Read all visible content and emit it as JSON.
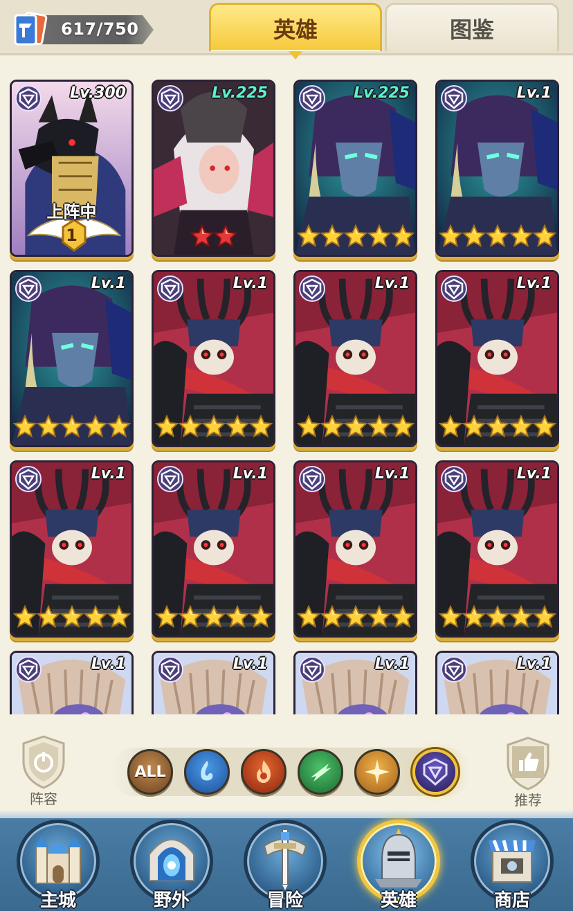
{
  "header": {
    "collection_count": "617/750",
    "tabs": [
      {
        "label": "英雄",
        "active": true
      },
      {
        "label": "图鉴",
        "active": false
      }
    ]
  },
  "cards": [
    {
      "level": "Lv.300",
      "level_color": "white",
      "art": "jackal",
      "stars": 0,
      "deployed_label": "上阵中",
      "rank": "1"
    },
    {
      "level": "Lv.225",
      "level_color": "teal",
      "art": "demon-girl",
      "stars": 2,
      "star_color": "red"
    },
    {
      "level": "Lv.225",
      "level_color": "teal",
      "art": "hooded-elf",
      "stars": 5
    },
    {
      "level": "Lv.1",
      "level_color": "white",
      "art": "hooded-elf",
      "stars": 5
    },
    {
      "level": "Lv.1",
      "level_color": "white",
      "art": "hooded-elf",
      "stars": 5
    },
    {
      "level": "Lv.1",
      "level_color": "white",
      "art": "skull-knight",
      "stars": 5
    },
    {
      "level": "Lv.1",
      "level_color": "white",
      "art": "skull-knight",
      "stars": 5
    },
    {
      "level": "Lv.1",
      "level_color": "white",
      "art": "skull-knight",
      "stars": 5
    },
    {
      "level": "Lv.1",
      "level_color": "white",
      "art": "skull-knight",
      "stars": 5
    },
    {
      "level": "Lv.1",
      "level_color": "white",
      "art": "skull-knight",
      "stars": 5
    },
    {
      "level": "Lv.1",
      "level_color": "white",
      "art": "skull-knight",
      "stars": 5
    },
    {
      "level": "Lv.1",
      "level_color": "white",
      "art": "skull-knight",
      "stars": 5
    },
    {
      "level": "Lv.1",
      "level_color": "white",
      "art": "mech-bird",
      "stars": 0
    },
    {
      "level": "Lv.1",
      "level_color": "white",
      "art": "mech-bird",
      "stars": 0
    },
    {
      "level": "Lv.1",
      "level_color": "white",
      "art": "mech-bird",
      "stars": 0
    },
    {
      "level": "Lv.1",
      "level_color": "white",
      "art": "mech-bird",
      "stars": 0
    }
  ],
  "filters": {
    "lineup_label": "阵容",
    "recommend_label": "推荐",
    "all_label": "ALL",
    "factions": [
      {
        "name": "all",
        "color": "#8a5a2a"
      },
      {
        "name": "water",
        "color": "#2a73c7"
      },
      {
        "name": "fire",
        "color": "#c2401c"
      },
      {
        "name": "nature",
        "color": "#2f9a48"
      },
      {
        "name": "light",
        "color": "#d38a1f"
      },
      {
        "name": "dark",
        "color": "#4a3a8e",
        "active": true
      }
    ]
  },
  "nav": [
    {
      "label": "主城",
      "icon": "castle-icon"
    },
    {
      "label": "野外",
      "icon": "portal-icon"
    },
    {
      "label": "冒险",
      "icon": "sword-icon"
    },
    {
      "label": "英雄",
      "icon": "knight-helmet-icon",
      "active": true
    },
    {
      "label": "商店",
      "icon": "shop-icon"
    }
  ]
}
